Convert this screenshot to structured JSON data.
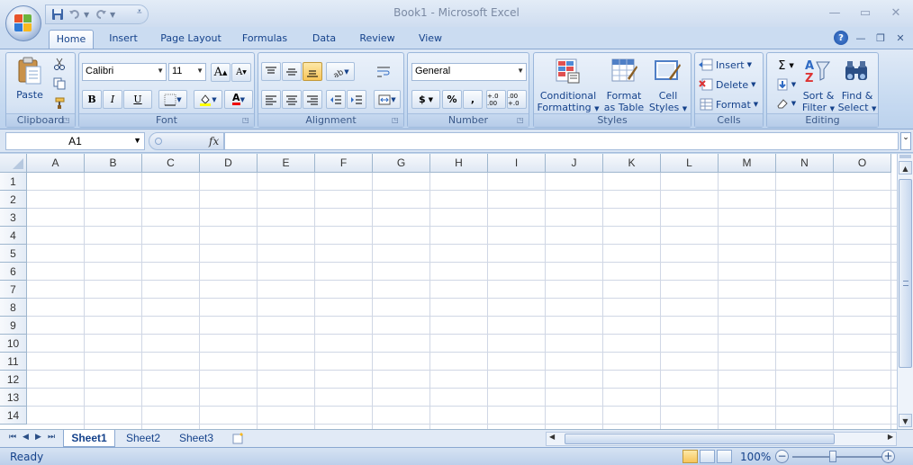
{
  "window": {
    "title": "Book1 - Microsoft Excel"
  },
  "qat": {
    "save_icon": "save-icon",
    "undo_icon": "undo-icon",
    "redo_icon": "redo-icon"
  },
  "tabs": [
    {
      "label": "Home",
      "active": true
    },
    {
      "label": "Insert"
    },
    {
      "label": "Page Layout"
    },
    {
      "label": "Formulas"
    },
    {
      "label": "Data"
    },
    {
      "label": "Review"
    },
    {
      "label": "View"
    }
  ],
  "ribbon": {
    "clipboard": {
      "label": "Clipboard",
      "paste": "Paste"
    },
    "font": {
      "label": "Font",
      "name": "Calibri",
      "size": "11",
      "bold": "B",
      "italic": "I",
      "underline": "U",
      "grow": "A",
      "shrink": "A",
      "font_color": "A"
    },
    "alignment": {
      "label": "Alignment"
    },
    "number": {
      "label": "Number",
      "format": "General",
      "currency": "$",
      "percent": "%",
      "comma": ",",
      "inc_decimal": "+.0 .00",
      "dec_decimal": ".00 +.0"
    },
    "styles": {
      "label": "Styles",
      "conditional": [
        "Conditional",
        "Formatting"
      ],
      "format_table": [
        "Format",
        "as Table"
      ],
      "cell_styles": [
        "Cell",
        "Styles"
      ]
    },
    "cells": {
      "label": "Cells",
      "insert": "Insert",
      "delete": "Delete",
      "format": "Format"
    },
    "editing": {
      "label": "Editing",
      "sum": "Σ",
      "sort": [
        "Sort &",
        "Filter"
      ],
      "find": [
        "Find &",
        "Select"
      ]
    }
  },
  "formula_bar": {
    "name_box": "A1",
    "fx": "fx",
    "value": ""
  },
  "grid": {
    "columns": [
      "A",
      "B",
      "C",
      "D",
      "E",
      "F",
      "G",
      "H",
      "I",
      "J",
      "K",
      "L",
      "M",
      "N",
      "O"
    ],
    "rows": [
      "1",
      "2",
      "3",
      "4",
      "5",
      "6",
      "7",
      "8",
      "9",
      "10",
      "11",
      "12",
      "13",
      "14"
    ]
  },
  "sheets": [
    {
      "label": "Sheet1",
      "active": true
    },
    {
      "label": "Sheet2"
    },
    {
      "label": "Sheet3"
    }
  ],
  "status": {
    "text": "Ready",
    "zoom": "100%",
    "minus": "−",
    "plus": "+"
  },
  "colors": {
    "accent": "#15428b",
    "ribbon": "#c8dbf1",
    "grid_line": "#d0d7e5"
  }
}
